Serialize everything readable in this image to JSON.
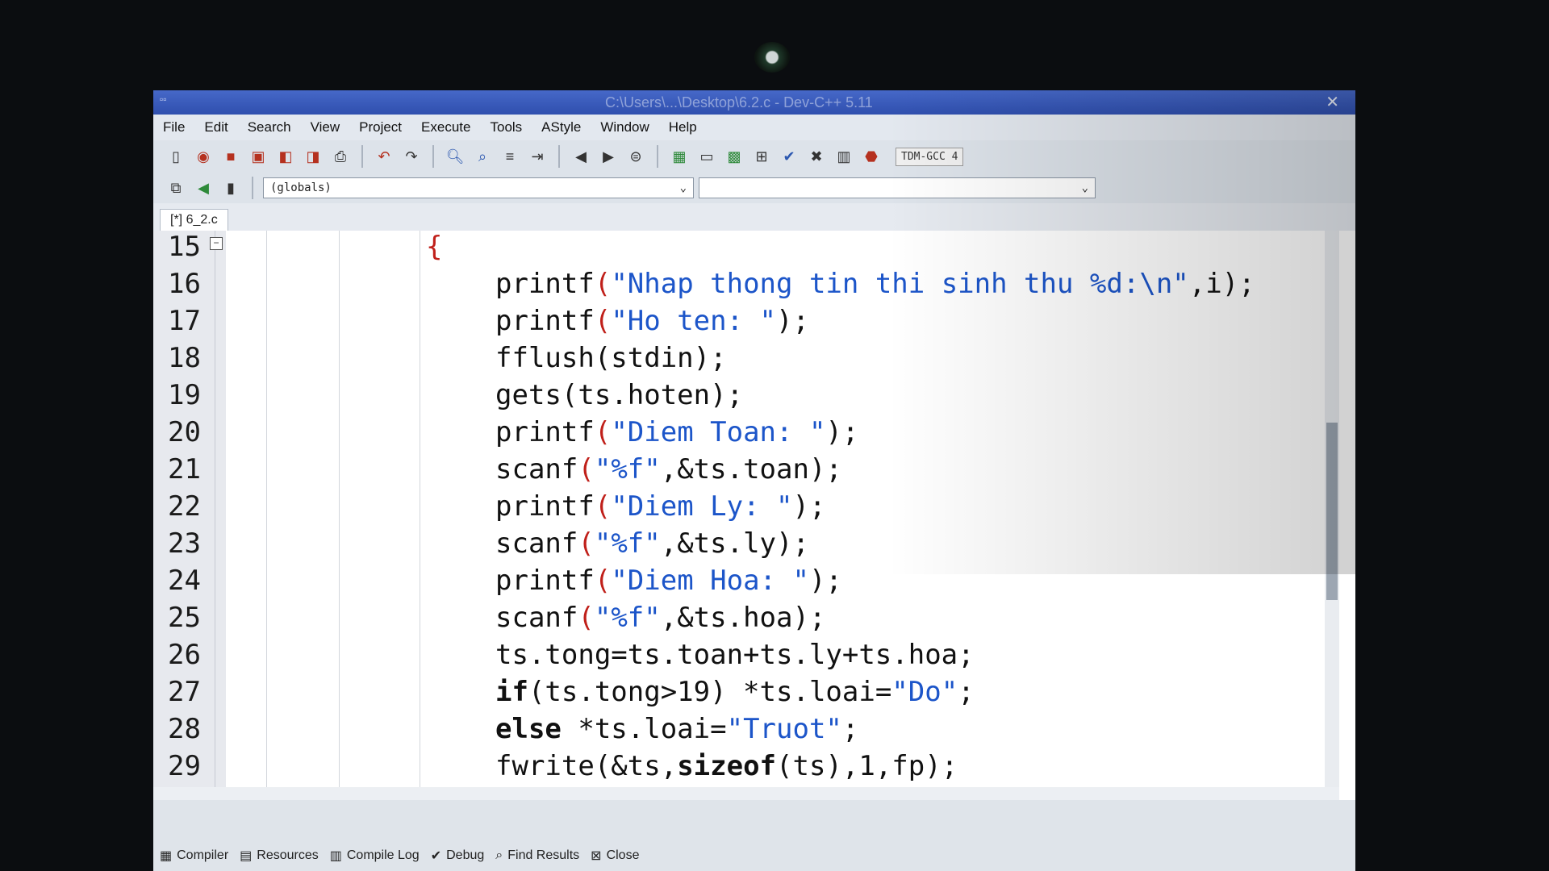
{
  "window": {
    "title": "C:\\Users\\...\\Desktop\\6.2.c - Dev-C++ 5.11"
  },
  "menu": [
    "File",
    "Edit",
    "Search",
    "View",
    "Project",
    "Execute",
    "Tools",
    "AStyle",
    "Window",
    "Help"
  ],
  "toolbar": {
    "compiler": "TDM-GCC 4"
  },
  "scope_combo": {
    "value": "(globals)"
  },
  "file_tab": {
    "label": "[*] 6_2.c"
  },
  "code_lines": [
    {
      "n": "15"
    },
    {
      "n": "16"
    },
    {
      "n": "17"
    },
    {
      "n": "18"
    },
    {
      "n": "19"
    },
    {
      "n": "20"
    },
    {
      "n": "21"
    },
    {
      "n": "22"
    },
    {
      "n": "23"
    },
    {
      "n": "24"
    },
    {
      "n": "25"
    },
    {
      "n": "26"
    },
    {
      "n": "27"
    },
    {
      "n": "28"
    },
    {
      "n": "29"
    }
  ],
  "code": {
    "l15": "{",
    "l16": {
      "fn": "printf",
      "str": "\"Nhap thong tin thi sinh thu %d:\\n\"",
      "tail": ",i);"
    },
    "l17": {
      "fn": "printf",
      "str": "\"Ho ten: \"",
      "tail": ");"
    },
    "l18": "fflush(stdin);",
    "l19": "gets(ts.hoten);",
    "l20": {
      "fn": "printf",
      "str": "\"Diem Toan: \"",
      "tail": ");"
    },
    "l21": {
      "fn": "scanf",
      "str": "\"%f\"",
      "tail": ",&ts.toan);"
    },
    "l22": {
      "fn": "printf",
      "str": "\"Diem Ly: \"",
      "tail": ");"
    },
    "l23": {
      "fn": "scanf",
      "str": "\"%f\"",
      "tail": ",&ts.ly);"
    },
    "l24": {
      "fn": "printf",
      "str": "\"Diem Hoa: \"",
      "tail": ");"
    },
    "l25": {
      "fn": "scanf",
      "str": "\"%f\"",
      "tail": ",&ts.hoa);"
    },
    "l26": "ts.tong=ts.toan+ts.ly+ts.hoa;",
    "l27": {
      "kw": "if",
      "mid": "(ts.tong>19) *ts.loai=",
      "str": "\"Do\"",
      "tail": ";"
    },
    "l28": {
      "kw": "else",
      "mid": " *ts.loai=",
      "str": "\"Truot\"",
      "tail": ";"
    },
    "l29": {
      "fn": "fwrite",
      "mid": "(&ts,",
      "kw": "sizeof",
      "tail": "(ts),1,fp);"
    }
  },
  "bottom_tabs": [
    "Compiler",
    "Resources",
    "Compile Log",
    "Debug",
    "Find Results",
    "Close"
  ]
}
